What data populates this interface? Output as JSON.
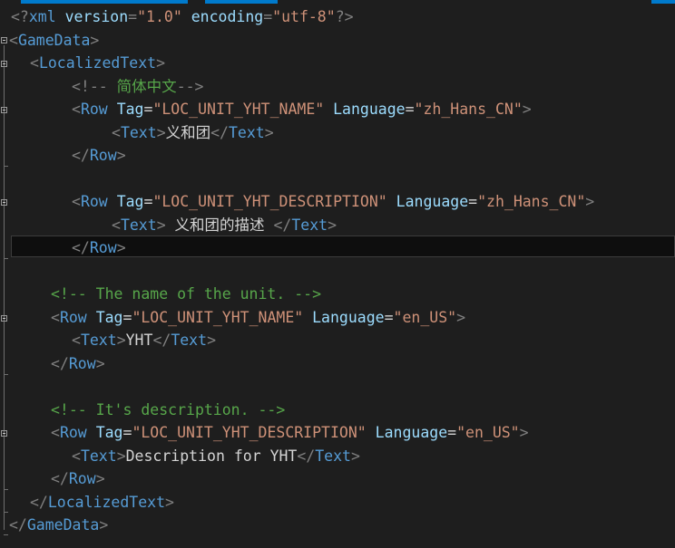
{
  "editor": {
    "xml_decl": {
      "open": "<?",
      "name": "xml",
      "attr1": "version",
      "eq1": "=",
      "val1": "\"1.0\"",
      "attr2": "encoding",
      "eq2": "=",
      "val2": "\"utf-8\"",
      "close": "?>"
    },
    "game_data_open": {
      "lt": "<",
      "name": "GameData",
      "gt": ">"
    },
    "localized_open": {
      "lt": "<",
      "name": "LocalizedText",
      "gt": ">"
    },
    "comment_zh_open": "<!--",
    "comment_zh_text": " 简体中文",
    "comment_zh_close": "-->",
    "row1": {
      "lt": "<",
      "name": "Row",
      "tag_attr": "Tag",
      "eq": "=",
      "tag_val": "\"LOC_UNIT_YHT_NAME\"",
      "lang_attr": "Language",
      "lang_val": "\"zh_Hans_CN\"",
      "gt": ">"
    },
    "row1_text": {
      "open_lt": "<",
      "open_name": "Text",
      "open_gt": ">",
      "content": "义和团",
      "close_lt": "</",
      "close_name": "Text",
      "close_gt": ">"
    },
    "row1_close": {
      "lt": "</",
      "name": "Row",
      "gt": ">"
    },
    "row2": {
      "lt": "<",
      "name": "Row",
      "tag_attr": "Tag",
      "eq": "=",
      "tag_val": "\"LOC_UNIT_YHT_DESCRIPTION\"",
      "lang_attr": "Language",
      "lang_val": "\"zh_Hans_CN\"",
      "gt": ">"
    },
    "row2_text": {
      "open_lt": "<",
      "open_name": "Text",
      "open_gt": ">",
      "content": " 义和团的描述 ",
      "close_lt": "</",
      "close_name": "Text",
      "close_gt": ">"
    },
    "row2_close": {
      "lt": "</",
      "name": "Row",
      "gt": ">"
    },
    "comment_name": "<!-- The name of the unit. -->",
    "row3": {
      "lt": "<",
      "name": "Row",
      "tag_attr": "Tag",
      "eq": "=",
      "tag_val": "\"LOC_UNIT_YHT_NAME\"",
      "lang_attr": "Language",
      "lang_val": "\"en_US\"",
      "gt": ">"
    },
    "row3_text": {
      "open_lt": "<",
      "open_name": "Text",
      "open_gt": ">",
      "content": "YHT",
      "close_lt": "</",
      "close_name": "Text",
      "close_gt": ">"
    },
    "row3_close": {
      "lt": "</",
      "name": "Row",
      "gt": ">"
    },
    "comment_desc": "<!-- It's description. -->",
    "row4": {
      "lt": "<",
      "name": "Row",
      "tag_attr": "Tag",
      "eq": "=",
      "tag_val": "\"LOC_UNIT_YHT_DESCRIPTION\"",
      "lang_attr": "Language",
      "lang_val": "\"en_US\"",
      "gt": ">"
    },
    "row4_text": {
      "open_lt": "<",
      "open_name": "Text",
      "open_gt": ">",
      "content": "Description for YHT",
      "close_lt": "</",
      "close_name": "Text",
      "close_gt": ">"
    },
    "row4_close": {
      "lt": "</",
      "name": "Row",
      "gt": ">"
    },
    "localized_close": {
      "lt": "</",
      "name": "LocalizedText",
      "gt": ">"
    },
    "game_data_close": {
      "lt": "</",
      "name": "GameData",
      "gt": ">"
    }
  },
  "colors": {
    "background": "#1e1e1e",
    "tag": "#569cd6",
    "attribute": "#9cdcfe",
    "string": "#ce9178",
    "comment": "#57a64a",
    "bracket": "#808080",
    "text": "#d4d4d4",
    "accent": "#007acc"
  }
}
